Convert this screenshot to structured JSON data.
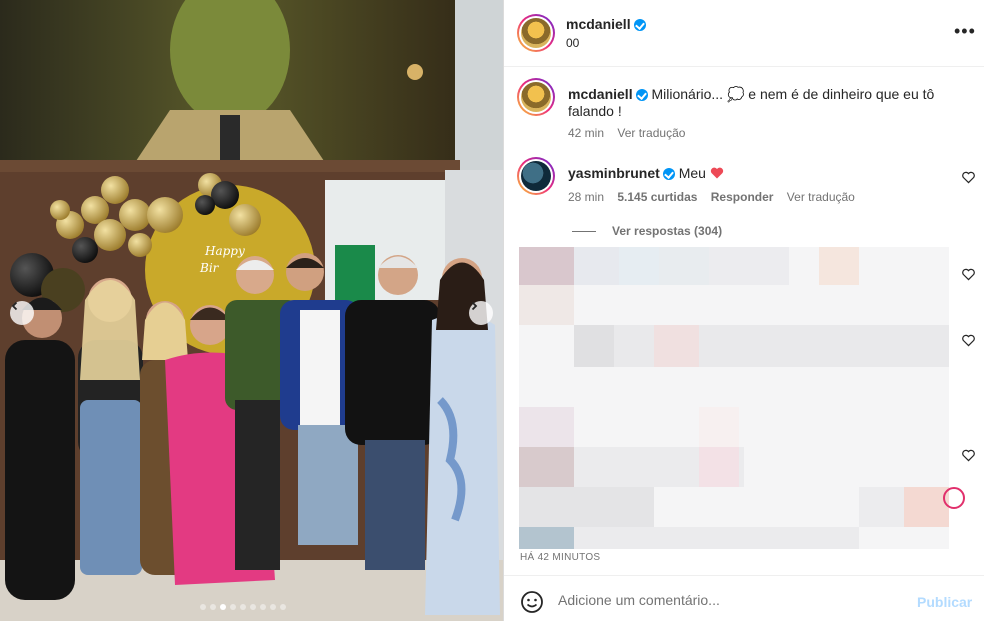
{
  "header": {
    "username": "mcdaniell",
    "subtitle": "00"
  },
  "caption": {
    "username": "mcdaniell",
    "text": "Milionário... 💭 e nem é de dinheiro que eu tô falando !",
    "time": "42 min",
    "translate": "Ver tradução"
  },
  "comment": {
    "username": "yasminbrunet",
    "text": "Meu",
    "time": "28 min",
    "likes": "5.145 curtidas",
    "reply": "Responder",
    "translate": "Ver tradução",
    "view_replies": "Ver respostas (304)"
  },
  "post_time": "HÁ 42 MINUTOS",
  "footer": {
    "placeholder": "Adicione um comentário...",
    "post": "Publicar"
  },
  "carousel": {
    "slide_count": 9,
    "active_index": 2
  },
  "icons": [
    "chevron-left-icon",
    "chevron-right-icon",
    "more-icon",
    "heart-icon",
    "emoji-icon",
    "verified-icon"
  ],
  "colors": {
    "accent": "#0095f6",
    "heart": "#ed4956",
    "post_disabled": "#b3dbff"
  }
}
